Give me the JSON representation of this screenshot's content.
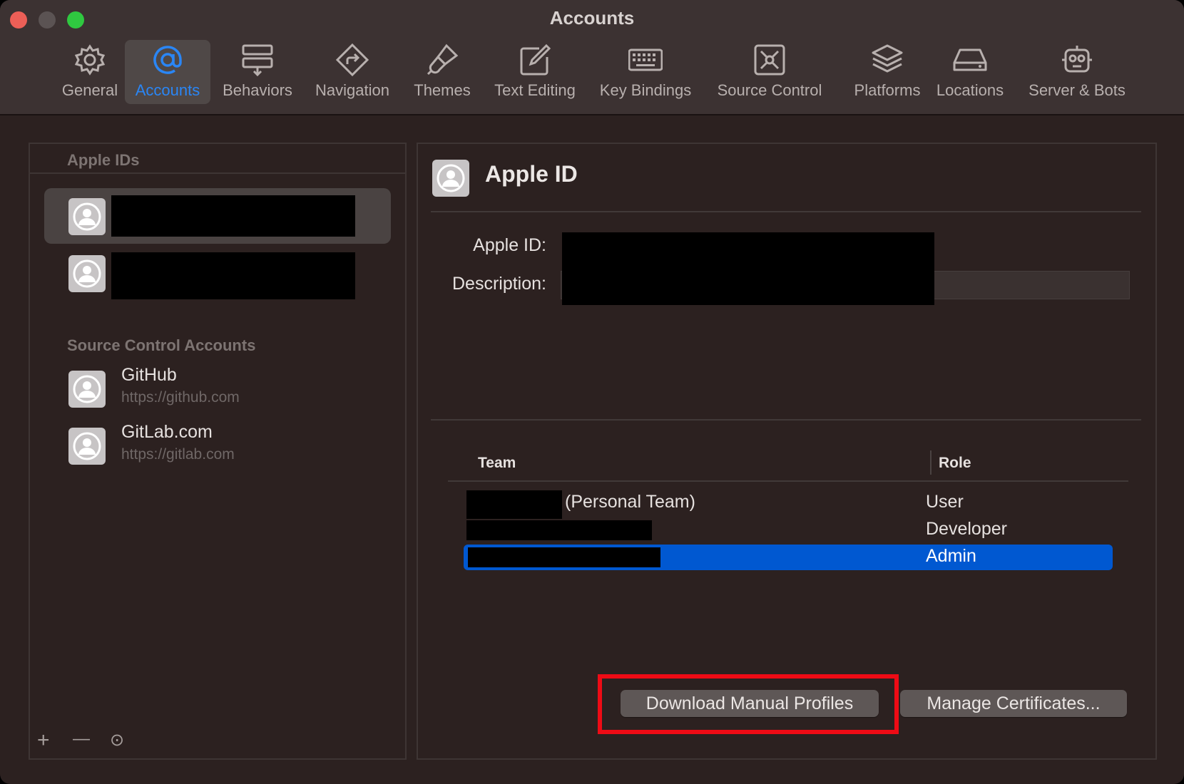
{
  "window": {
    "title": "Accounts"
  },
  "toolbar": {
    "tabs": [
      {
        "label": "General",
        "icon": "gear-icon"
      },
      {
        "label": "Accounts",
        "icon": "at-sign-icon",
        "active": true
      },
      {
        "label": "Behaviors",
        "icon": "behaviors-icon"
      },
      {
        "label": "Navigation",
        "icon": "navigation-arrow-icon"
      },
      {
        "label": "Themes",
        "icon": "paintbrush-icon"
      },
      {
        "label": "Text Editing",
        "icon": "pencil-square-icon"
      },
      {
        "label": "Key Bindings",
        "icon": "keyboard-icon"
      },
      {
        "label": "Source Control",
        "icon": "source-control-icon"
      },
      {
        "label": "Platforms",
        "icon": "layers-icon"
      },
      {
        "label": "Locations",
        "icon": "disk-drive-icon"
      },
      {
        "label": "Server & Bots",
        "icon": "robot-icon"
      }
    ]
  },
  "sidebar": {
    "apple_ids_title": "Apple IDs",
    "source_control_title": "Source Control Accounts",
    "source_control_accounts": [
      {
        "name": "GitHub",
        "url": "https://github.com"
      },
      {
        "name": "GitLab.com",
        "url": "https://gitlab.com"
      }
    ],
    "controls": {
      "add": "+",
      "remove": "—",
      "more": "⊙"
    }
  },
  "detail": {
    "title": "Apple ID",
    "apple_id_label": "Apple ID:",
    "description_label": "Description:",
    "table": {
      "headers": {
        "team": "Team",
        "role": "Role"
      },
      "rows": [
        {
          "team_suffix": "(Personal Team)",
          "role": "User"
        },
        {
          "team_suffix": "",
          "role": "Developer"
        },
        {
          "team_suffix": "",
          "role": "Admin",
          "selected": true
        }
      ]
    },
    "buttons": {
      "download": "Download Manual Profiles",
      "manage": "Manage Certificates..."
    }
  },
  "colors": {
    "accent": "#2a86f5",
    "selection": "#0058d1",
    "highlight": "#ee0b15"
  }
}
